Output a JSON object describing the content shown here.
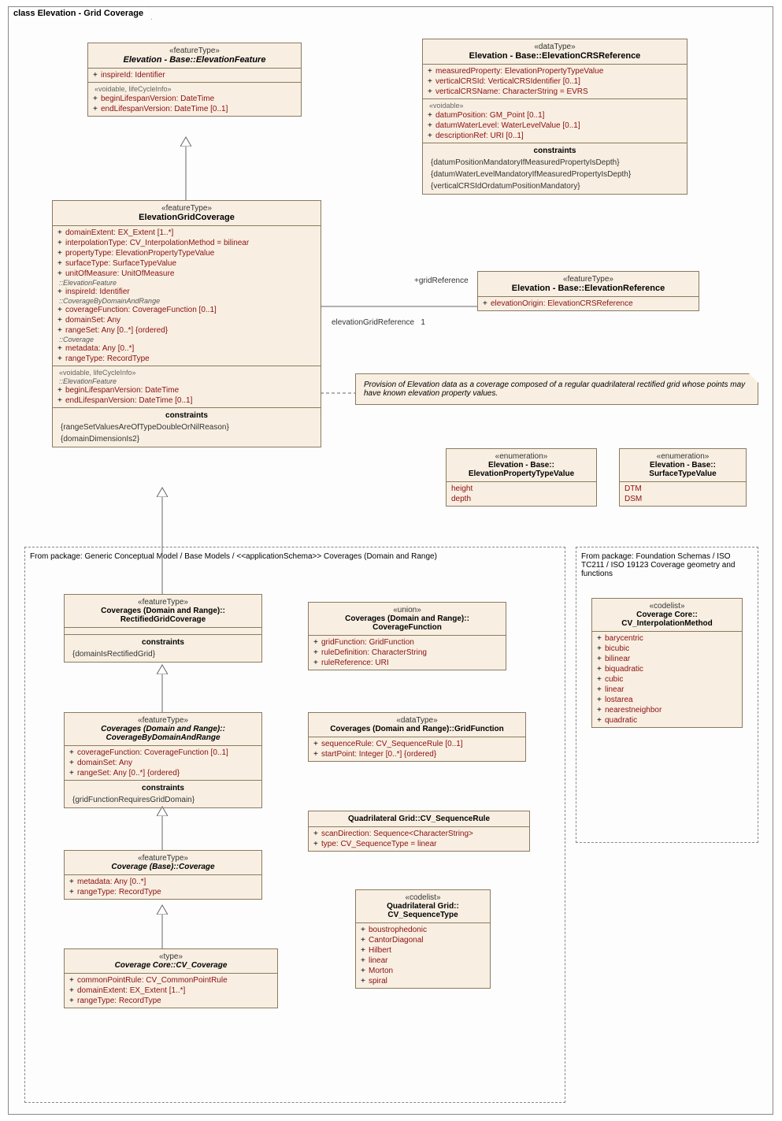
{
  "diagram_title": "class Elevation - Grid Coverage",
  "elevation_feature": {
    "stereo": "«featureType»",
    "title": "Elevation - Base::ElevationFeature",
    "attrs": [
      "inspireId:  Identifier"
    ],
    "voidable_label": "«voidable, lifeCycleInfo»",
    "voidable": [
      "beginLifespanVersion:  DateTime",
      "endLifespanVersion:  DateTime [0..1]"
    ]
  },
  "elevation_crs_ref": {
    "stereo": "«dataType»",
    "title": "Elevation - Base::ElevationCRSReference",
    "attrs": [
      "measuredProperty:  ElevationPropertyTypeValue",
      "verticalCRSId:  VerticalCRSIdentifier [0..1]",
      "verticalCRSName:  CharacterString = EVRS"
    ],
    "voidable_label": "«voidable»",
    "voidable": [
      "datumPosition:  GM_Point [0..1]",
      "datumWaterLevel:  WaterLevelValue [0..1]",
      "descriptionRef:  URI [0..1]"
    ],
    "constraints_h": "constraints",
    "constraints": [
      "{datumPositionMandatoryIfMeasuredPropertyIsDepth}",
      "{datumWaterLevelMandatoryIfMeasuredPropertyIsDepth}",
      "{verticalCRSIdOrdatumPositionMandatory}"
    ]
  },
  "grid_coverage": {
    "stereo": "«featureType»",
    "title": "ElevationGridCoverage",
    "own": [
      "domainExtent:  EX_Extent [1..*]",
      "interpolationType:  CV_InterpolationMethod = bilinear",
      "propertyType:  ElevationPropertyTypeValue",
      "surfaceType:  SurfaceTypeValue",
      "unitOfMeasure:  UnitOfMeasure"
    ],
    "ef_label": "::ElevationFeature",
    "ef": [
      "inspireId:  Identifier"
    ],
    "cdr_label": "::CoverageByDomainAndRange",
    "cdr": [
      "coverageFunction:  CoverageFunction [0..1]",
      "domainSet:  Any",
      "rangeSet:  Any [0..*] {ordered}"
    ],
    "cov_label": "::Coverage",
    "cov": [
      "metadata:  Any [0..*]",
      "rangeType:  RecordType"
    ],
    "vlc_label": "«voidable, lifeCycleInfo»",
    "ef2_label": "::ElevationFeature",
    "vlc": [
      "beginLifespanVersion:  DateTime",
      "endLifespanVersion:  DateTime [0..1]"
    ],
    "constraints_h": "constraints",
    "constraints": [
      "{rangeSetValuesAreOfTypeDoubleOrNilReason}",
      "{domainDimensionIs2}"
    ]
  },
  "elevation_ref": {
    "stereo": "«featureType»",
    "title": "Elevation - Base::ElevationReference",
    "attrs": [
      "elevationOrigin:  ElevationCRSReference"
    ]
  },
  "assoc": {
    "grid_ref": "+gridReference",
    "egr": "elevationGridReference",
    "mult": "1"
  },
  "note_text": "Provision of Elevation data as a coverage composed of a regular quadrilateral rectified grid whose points may have known elevation property values.",
  "enum_eptv": {
    "stereo": "«enumeration»",
    "title": "Elevation - Base:: ElevationPropertyTypeValue",
    "vals": [
      "height",
      "depth"
    ]
  },
  "enum_stv": {
    "stereo": "«enumeration»",
    "title": "Elevation - Base:: SurfaceTypeValue",
    "vals": [
      "DTM",
      "DSM"
    ]
  },
  "pkg1_label": "From package: Generic Conceptual Model / Base Models / <<applicationSchema>> Coverages (Domain and Range)",
  "pkg2_label": "From package: Foundation Schemas / ISO TC211 / ISO 19123 Coverage geometry and functions",
  "rgc": {
    "stereo": "«featureType»",
    "title": "Coverages (Domain and Range):: RectifiedGridCoverage",
    "constraints_h": "constraints",
    "constraints": [
      "{domainIsRectifiedGrid}"
    ]
  },
  "cbdr": {
    "stereo": "«featureType»",
    "title": "Coverages (Domain and Range):: CoverageByDomainAndRange",
    "attrs": [
      "coverageFunction:  CoverageFunction [0..1]",
      "domainSet:  Any",
      "rangeSet:  Any [0..*] {ordered}"
    ],
    "constraints_h": "constraints",
    "constraints": [
      "{gridFunctionRequiresGridDomain}"
    ]
  },
  "cb_cov": {
    "stereo": "«featureType»",
    "title": "Coverage (Base)::Coverage",
    "attrs": [
      "metadata:  Any [0..*]",
      "rangeType:  RecordType"
    ]
  },
  "cv_cov": {
    "stereo": "«type»",
    "title": "Coverage Core::CV_Coverage",
    "attrs": [
      "commonPointRule:  CV_CommonPointRule",
      "domainExtent:  EX_Extent [1..*]",
      "rangeType:  RecordType"
    ]
  },
  "union_cf": {
    "stereo": "«union»",
    "title": "Coverages (Domain and Range):: CoverageFunction",
    "attrs": [
      "gridFunction:  GridFunction",
      "ruleDefinition:  CharacterString",
      "ruleReference:  URI"
    ]
  },
  "dt_gf": {
    "stereo": "«dataType»",
    "title": "Coverages (Domain and Range)::GridFunction",
    "attrs": [
      "sequenceRule:  CV_SequenceRule [0..1]",
      "startPoint:  Integer [0..*] {ordered}"
    ]
  },
  "cv_seqrule": {
    "title": "Quadrilateral Grid::CV_SequenceRule",
    "attrs": [
      "scanDirection:  Sequence<CharacterString>",
      "type:  CV_SequenceType = linear"
    ]
  },
  "cv_seqtype": {
    "stereo": "«codelist»",
    "title": "Quadrilateral Grid:: CV_SequenceType",
    "vals": [
      "boustrophedonic",
      "CantorDiagonal",
      "Hilbert",
      "linear",
      "Morton",
      "spiral"
    ]
  },
  "cv_interp": {
    "stereo": "«codelist»",
    "title": "Coverage Core:: CV_InterpolationMethod",
    "vals": [
      "barycentric",
      "bicubic",
      "bilinear",
      "biquadratic",
      "cubic",
      "linear",
      "lostarea",
      "nearestneighbor",
      "quadratic"
    ]
  }
}
